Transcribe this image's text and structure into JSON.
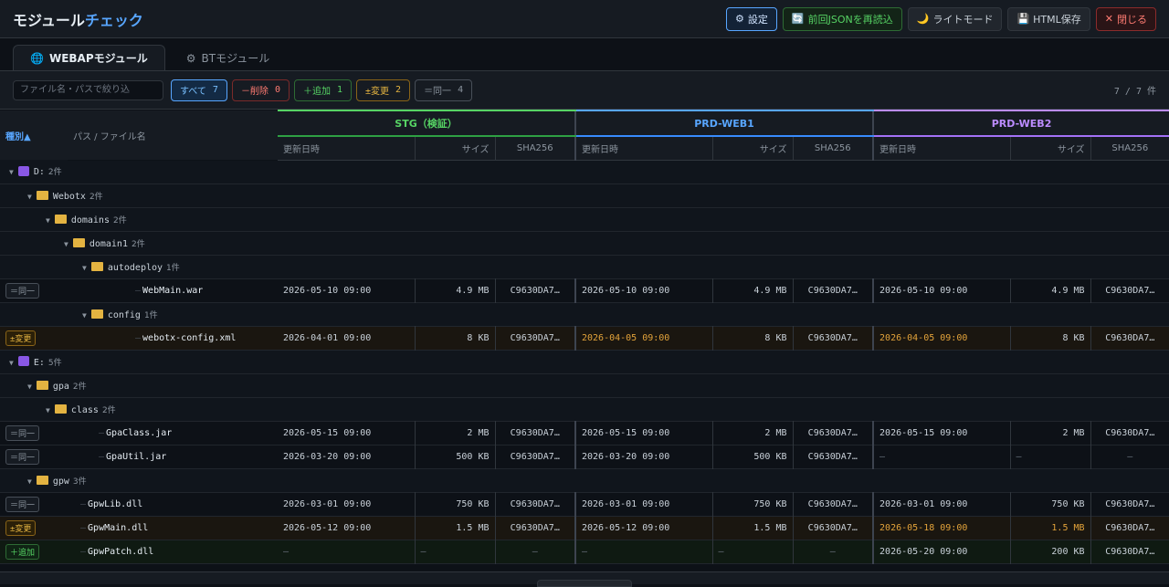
{
  "app": {
    "title_a": "モジュール",
    "title_b": "チェック"
  },
  "actions": {
    "settings": "設定",
    "reload": "前回JSONを再読込",
    "theme": "ライトモード",
    "save_html": "HTML保存",
    "close": "閉じる"
  },
  "tabs": [
    {
      "label": "WEBAPモジュール",
      "icon": "globe-icon",
      "active": true
    },
    {
      "label": "BTモジュール",
      "icon": "gear-icon",
      "active": false
    }
  ],
  "filter": {
    "placeholder": "ファイル名・パスで絞り込",
    "all": "すべて",
    "all_n": "7",
    "del": "－削除",
    "del_n": "0",
    "add": "＋追加",
    "add_n": "1",
    "chg": "±変更",
    "chg_n": "2",
    "same": "＝同一",
    "same_n": "4",
    "count": "7 / 7 件"
  },
  "table": {
    "kind_header": "種別▲",
    "path_header": "パス / ファイル名",
    "envs": [
      "STG（検証）",
      "PRD-WEB1",
      "PRD-WEB2"
    ],
    "col_date": "更新日時",
    "col_size": "サイズ",
    "col_sha": "SHA256"
  },
  "rows": [
    {
      "type": "dir",
      "level": 0,
      "name": "D:",
      "count": "2件",
      "drive": true
    },
    {
      "type": "dir",
      "level": 1,
      "name": "Webotx",
      "count": "2件"
    },
    {
      "type": "dir",
      "level": 2,
      "name": "domains",
      "count": "2件"
    },
    {
      "type": "dir",
      "level": 3,
      "name": "domain1",
      "count": "2件"
    },
    {
      "type": "dir",
      "level": 4,
      "name": "autodeploy",
      "count": "1件"
    },
    {
      "type": "file",
      "status": "same",
      "badge": "＝同一",
      "level": 5,
      "name": "WebMain.war",
      "stg": {
        "date": "2026-05-10 09:00",
        "size": "4.9 MB",
        "sha": "C9630DA7…"
      },
      "web1": {
        "date": "2026-05-10 09:00",
        "size": "4.9 MB",
        "sha": "C9630DA7…"
      },
      "web2": {
        "date": "2026-05-10 09:00",
        "size": "4.9 MB",
        "sha": "C9630DA7…"
      }
    },
    {
      "type": "dir",
      "level": 4,
      "name": "config",
      "count": "1件"
    },
    {
      "type": "file",
      "status": "chg",
      "badge": "±変更",
      "level": 5,
      "name": "webotx-config.xml",
      "stg": {
        "date": "2026-04-01 09:00",
        "size": "8 KB",
        "sha": "C9630DA7…"
      },
      "web1": {
        "date": "2026-04-05 09:00",
        "size": "8 KB",
        "sha": "C9630DA7…",
        "diff_date": true
      },
      "web2": {
        "date": "2026-04-05 09:00",
        "size": "8 KB",
        "sha": "C9630DA7…",
        "diff_date": true
      }
    },
    {
      "type": "dir",
      "level": 0,
      "name": "E:",
      "count": "5件",
      "drive": true
    },
    {
      "type": "dir",
      "level": 1,
      "name": "gpa",
      "count": "2件"
    },
    {
      "type": "dir",
      "level": 2,
      "name": "class",
      "count": "2件"
    },
    {
      "type": "file",
      "status": "same",
      "badge": "＝同一",
      "level": 3,
      "name": "GpaClass.jar",
      "stg": {
        "date": "2026-05-15 09:00",
        "size": "2 MB",
        "sha": "C9630DA7…"
      },
      "web1": {
        "date": "2026-05-15 09:00",
        "size": "2 MB",
        "sha": "C9630DA7…"
      },
      "web2": {
        "date": "2026-05-15 09:00",
        "size": "2 MB",
        "sha": "C9630DA7…"
      }
    },
    {
      "type": "file",
      "status": "same",
      "badge": "＝同一",
      "level": 3,
      "name": "GpaUtil.jar",
      "stg": {
        "date": "2026-03-20 09:00",
        "size": "500 KB",
        "sha": "C9630DA7…"
      },
      "web1": {
        "date": "2026-03-20 09:00",
        "size": "500 KB",
        "sha": "C9630DA7…"
      },
      "web2": {
        "date": "—",
        "size": "—",
        "sha": "—",
        "missing": true
      }
    },
    {
      "type": "dir",
      "level": 1,
      "name": "gpw",
      "count": "3件"
    },
    {
      "type": "file",
      "status": "same",
      "badge": "＝同一",
      "level": 2,
      "name": "GpwLib.dll",
      "stg": {
        "date": "2026-03-01 09:00",
        "size": "750 KB",
        "sha": "C9630DA7…"
      },
      "web1": {
        "date": "2026-03-01 09:00",
        "size": "750 KB",
        "sha": "C9630DA7…"
      },
      "web2": {
        "date": "2026-03-01 09:00",
        "size": "750 KB",
        "sha": "C9630DA7…"
      }
    },
    {
      "type": "file",
      "status": "chg",
      "badge": "±変更",
      "level": 2,
      "name": "GpwMain.dll",
      "stg": {
        "date": "2026-05-12 09:00",
        "size": "1.5 MB",
        "sha": "C9630DA7…"
      },
      "web1": {
        "date": "2026-05-12 09:00",
        "size": "1.5 MB",
        "sha": "C9630DA7…"
      },
      "web2": {
        "date": "2026-05-18 09:00",
        "size": "1.5 MB",
        "sha": "C9630DA7…",
        "diff_date": true,
        "diff_size": true
      }
    },
    {
      "type": "file",
      "status": "add",
      "badge": "＋追加",
      "level": 2,
      "name": "GpwPatch.dll",
      "stg": {
        "date": "—",
        "size": "—",
        "sha": "—",
        "missing": true
      },
      "web1": {
        "date": "—",
        "size": "—",
        "sha": "—",
        "missing": true
      },
      "web2": {
        "date": "2026-05-20 09:00",
        "size": "200 KB",
        "sha": "C9630DA7…"
      }
    }
  ]
}
